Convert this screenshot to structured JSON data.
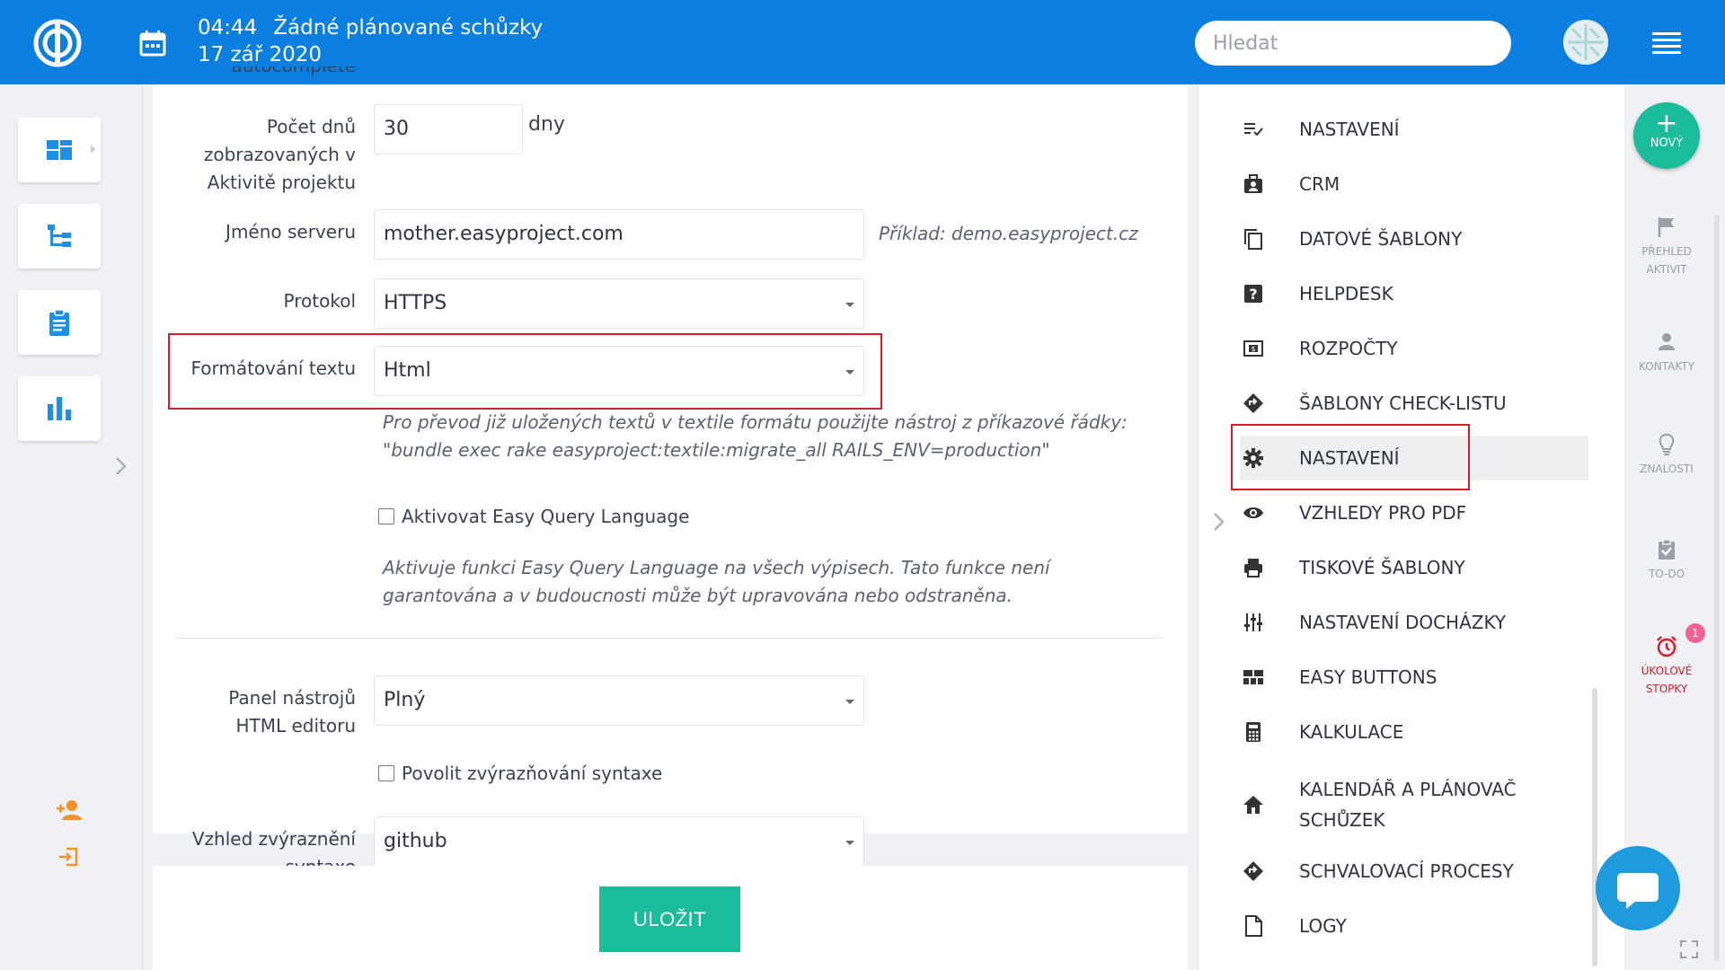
{
  "header": {
    "time": "04:44",
    "meetings": "Žádné plánované schůzky",
    "date": "17 zář 2020",
    "search_placeholder": "Hledat"
  },
  "form": {
    "cut_label_top": "autocomplete",
    "days": {
      "label": "Počet dnů zobrazovaných v Aktivitě projektu",
      "value": "30",
      "unit": "dny"
    },
    "server": {
      "label": "Jméno serveru",
      "value": "mother.easyproject.com",
      "example": "Příklad: demo.easyproject.cz"
    },
    "protocol": {
      "label": "Protokol",
      "value": "HTTPS"
    },
    "text_format": {
      "label": "Formátování textu",
      "value": "Html",
      "hint": "Pro převod již uložených textů v textile formátu použijte nástroj z příkazové řádky: \"bundle exec rake easyproject:textile:migrate_all RAILS_ENV=production\""
    },
    "eql": {
      "label": "Aktivovat Easy Query Language",
      "hint": "Aktivuje funkci Easy Query Language na všech výpisech. Tato funkce není garantována a v budoucnosti může být upravována nebo odstraněna."
    },
    "html_toolbar": {
      "label": "Panel nástrojů HTML editoru",
      "value": "Plný"
    },
    "syntax": {
      "label": "Povolit zvýrazňování syntaxe"
    },
    "syntax_theme": {
      "label": "Vzhled zvýraznění syntaxe",
      "value": "github"
    },
    "save_label": "ULOŽIT"
  },
  "menu": {
    "items": [
      {
        "label": "NASTAVENÍ",
        "icon": "list-check-icon"
      },
      {
        "label": "CRM",
        "icon": "briefcase-user-icon"
      },
      {
        "label": "DATOVÉ ŠABLONY",
        "icon": "copy-icon"
      },
      {
        "label": "HELPDESK",
        "icon": "question-box-icon"
      },
      {
        "label": "ROZPOČTY",
        "icon": "money-icon"
      },
      {
        "label": "ŠABLONY CHECK-LISTU",
        "icon": "diamond-arrow-icon"
      },
      {
        "label": "NASTAVENÍ",
        "icon": "gear-icon"
      },
      {
        "label": "VZHLEDY PRO PDF",
        "icon": "eye-icon"
      },
      {
        "label": "TISKOVÉ ŠABLONY",
        "icon": "printer-icon"
      },
      {
        "label": "NASTAVENÍ DOCHÁZKY",
        "icon": "sliders-icon"
      },
      {
        "label": "EASY BUTTONS",
        "icon": "buttons-grid-icon"
      },
      {
        "label": "KALKULACE",
        "icon": "calculator-icon"
      },
      {
        "label": "KALENDÁŘ A PLÁNOVAČ SCHŮZEK",
        "icon": "home-icon"
      },
      {
        "label": "SCHVALOVACÍ PROCESY",
        "icon": "diamond-arrow-icon"
      },
      {
        "label": "LOGY",
        "icon": "file-icon"
      }
    ]
  },
  "strip": {
    "new_label": "NOVÝ",
    "activity": "PŘEHLED AKTIVIT",
    "contacts": "KONTAKTY",
    "knowledge": "ZNALOSTI",
    "todo": "TO-DO",
    "timers": "ÚKOLOVÉ STOPKY",
    "timers_badge": "1"
  },
  "colors": {
    "header": "#0a7fe0",
    "accent": "#1abc9c",
    "highlight": "#d0202c",
    "icon_blue": "#1e8fe6"
  }
}
